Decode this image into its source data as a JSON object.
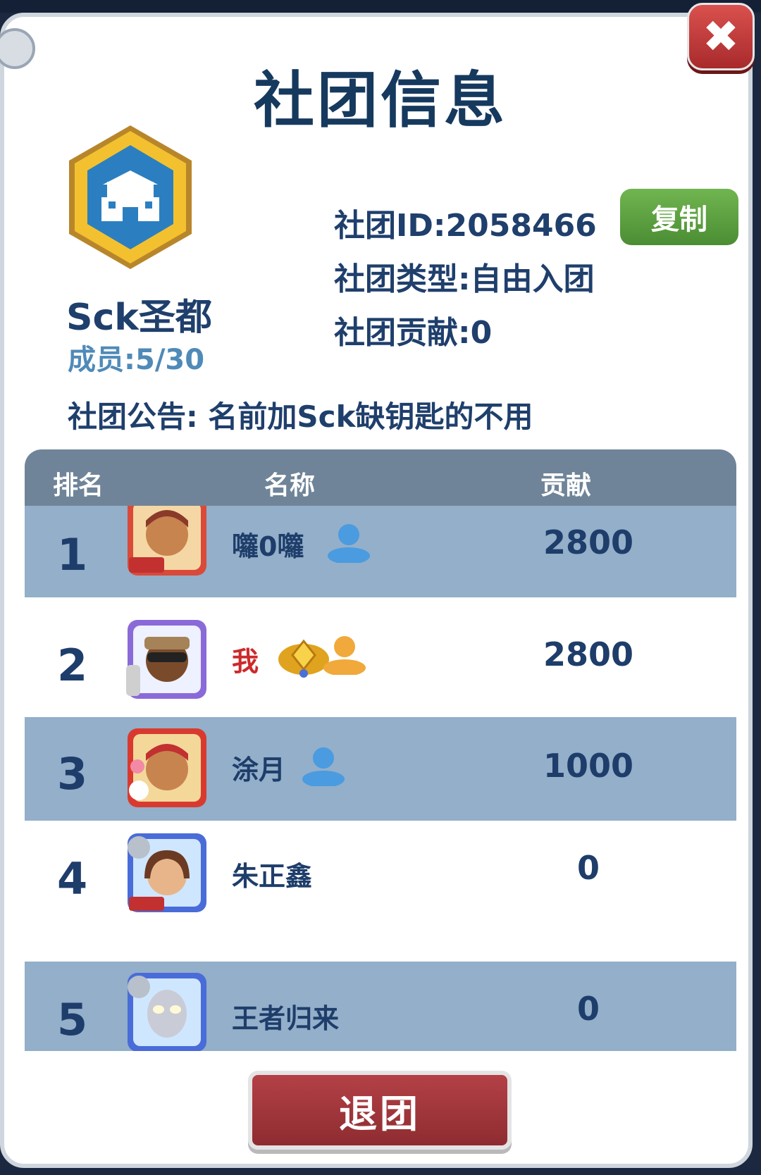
{
  "dialog": {
    "title": "社团信息",
    "close_label": "✖"
  },
  "club": {
    "name": "Sck圣都",
    "members": "成员:5/30",
    "id_text": "社团ID:2058466",
    "copy_label": "复制",
    "type_text": "社团类型:自由入团",
    "contribution_text": "社团贡献:0",
    "notice_text": "社团公告: 名前加Sck缺钥匙的不用"
  },
  "table": {
    "headers": {
      "rank": "排名",
      "name": "名称",
      "contribution": "贡献"
    },
    "rows": [
      {
        "rank": "1",
        "name": "囖0囖",
        "score": "2800",
        "avatar_icon": "surfer-avatar-icon",
        "status_icon": "person-icon-blue"
      },
      {
        "rank": "2",
        "name": "我",
        "score": "2800",
        "avatar_icon": "sunglasses-avatar-icon",
        "status_icon": "person-icon-orange",
        "badge_icon": "gold-rank-badge-icon"
      },
      {
        "rank": "3",
        "name": "涂月",
        "score": "1000",
        "avatar_icon": "new-year-avatar-icon",
        "status_icon": "person-icon-blue"
      },
      {
        "rank": "4",
        "name": "朱正鑫",
        "score": "0",
        "avatar_icon": "girl-avatar-icon"
      },
      {
        "rank": "5",
        "name": "王者归来",
        "score": "0",
        "avatar_icon": "hero-avatar-icon"
      }
    ]
  },
  "footer": {
    "leave_label": "退团"
  },
  "colors": {
    "title": "#16395e",
    "text_dark": "#1f3f6c",
    "members": "#4f8ab8",
    "row_alt": "#93afc9",
    "header": "#6f8498",
    "copy_green": "#5a9e3e",
    "leave_red": "#a13a3e",
    "me_red": "#cc2a2a"
  }
}
